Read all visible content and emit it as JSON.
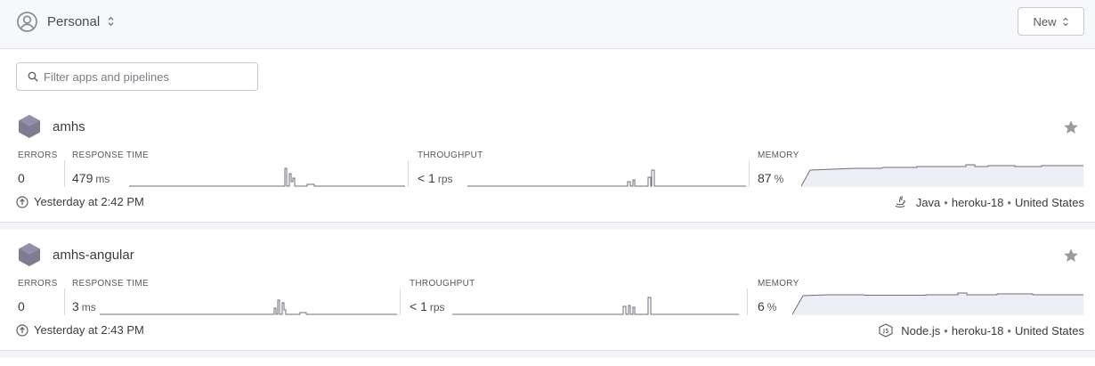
{
  "header": {
    "account_label": "Personal",
    "new_button_label": "New"
  },
  "filter": {
    "placeholder": "Filter apps and pipelines"
  },
  "labels": {
    "errors": "ERRORS",
    "response_time": "RESPONSE TIME",
    "throughput": "THROUGHPUT",
    "memory": "MEMORY"
  },
  "apps": [
    {
      "name": "amhs",
      "errors": "0",
      "response_time": "479",
      "response_unit": "ms",
      "throughput": "< 1",
      "throughput_unit": "rps",
      "memory": "87",
      "memory_unit": "%",
      "last_deploy": "Yesterday at 2:42 PM",
      "language": "Java",
      "stack": "heroku-18",
      "region": "United States",
      "language_icon": "java-icon"
    },
    {
      "name": "amhs-angular",
      "errors": "0",
      "response_time": "3",
      "response_unit": "ms",
      "throughput": "< 1",
      "throughput_unit": "rps",
      "memory": "6",
      "memory_unit": "%",
      "last_deploy": "Yesterday at 2:43 PM",
      "language": "Node.js",
      "stack": "heroku-18",
      "region": "United States",
      "language_icon": "nodejs-icon"
    }
  ],
  "separator": "•",
  "colors": {
    "line": "#6d6e7c",
    "fill": "#eceef3",
    "hex": "#7f7b90",
    "star": "#9a9aa3"
  }
}
